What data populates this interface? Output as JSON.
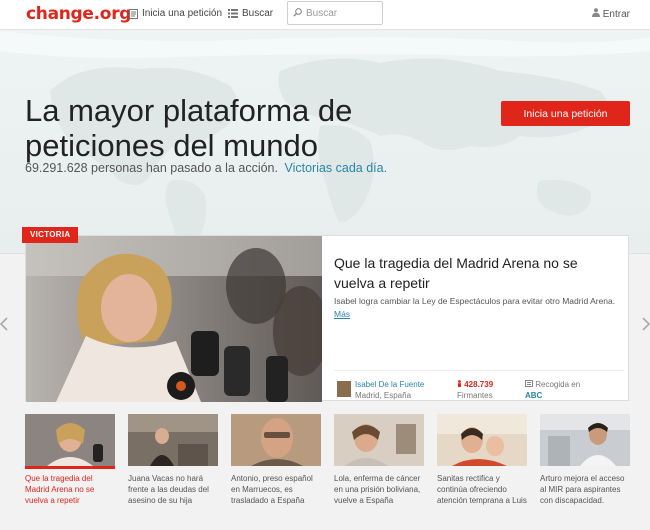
{
  "header": {
    "logo": "change.org",
    "nav_start": "Inicia una petición",
    "nav_search": "Buscar",
    "search_placeholder": "Buscar",
    "login": "Entrar"
  },
  "hero": {
    "title": "La mayor plataforma de peticiones del mundo",
    "stats_text": "69.291.628 personas han pasado a la acción.",
    "victories_link": "Victorias cada día.",
    "cta_label": "Inicia una petición"
  },
  "featured": {
    "badge": "VICTORIA",
    "title": "Que la tragedia del Madrid Arena no se vuelva a repetir",
    "description": "Isabel logra cambiar la Ley de Espectáculos para evitar otro Madrid Arena.",
    "more_link": "Más",
    "author_name": "Isabel De la Fuente",
    "author_location": "Madrid, España",
    "signers_count": "428.739",
    "signers_label": "Firmantes",
    "press_label": "Recogida en",
    "press_source": "ABC"
  },
  "thumbnails": [
    {
      "caption": "Que la tragedia del Madrid Arena no se vuelva a repetir",
      "active": true
    },
    {
      "caption": "Juana Vacas no hará frente a las deudas del asesino de su hija",
      "active": false
    },
    {
      "caption": "Antonio, preso español en Marruecos, es trasladado a España",
      "active": false
    },
    {
      "caption": "Lola, enferma de cáncer en una prisión boliviana, vuelve a España",
      "active": false
    },
    {
      "caption": "Sanitas rectifica y continúa ofreciendo atención temprana a Luis",
      "active": false
    },
    {
      "caption": "Arturo mejora el acceso al MIR para aspirantes con discapacidad.",
      "active": false
    }
  ],
  "colors": {
    "brand_red": "#e0261b",
    "link_blue": "#2a84a8"
  },
  "icons": {
    "nav_start": "document-icon",
    "nav_search": "list-icon",
    "search": "search-icon",
    "login": "user-icon",
    "prev": "chevron-left-icon",
    "next": "chevron-right-icon"
  }
}
